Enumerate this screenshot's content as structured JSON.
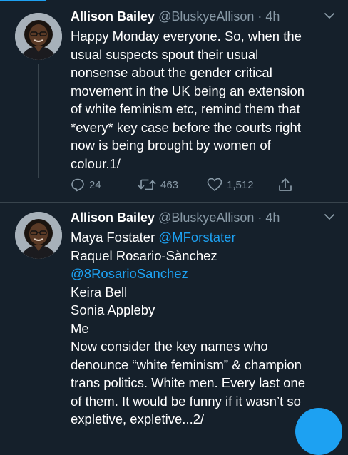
{
  "tweets": [
    {
      "author_name": "Allison Bailey",
      "handle": "@BluskyeAllison",
      "separator": "·",
      "time": "4h",
      "lines": [
        "Happy Monday everyone. So, when the",
        "usual suspects spout their usual",
        "nonsense about the gender critical",
        "movement in the UK being an extension",
        "of white feminism etc, remind them that",
        "*every* key case before the courts right",
        "now is being brought by women of",
        "colour.1/"
      ],
      "actions": {
        "replies": "24",
        "retweets": "463",
        "likes": "1,512"
      }
    },
    {
      "author_name": "Allison Bailey",
      "handle": "@BluskyeAllison",
      "separator": "·",
      "time": "4h",
      "line1_text": "Maya Fostater",
      "line1_mention": "@MForstater",
      "line2_text": "Raquel Rosario-Sànchez",
      "line3_mention": "@8RosarioSanchez",
      "lines_rest": [
        "Keira Bell",
        "Sonia Appleby",
        "Me",
        "Now consider the key names who",
        "denounce “white feminism” & champion",
        "trans politics. White men. Every last one",
        "of them. It would be funny if it wasn’t so",
        "expletive, expletive...2/"
      ]
    }
  ],
  "icons": {
    "reply": "reply-icon",
    "retweet": "retweet-icon",
    "like": "heart-icon",
    "share": "share-icon",
    "more": "chevron-down-icon",
    "compose": "compose-fab"
  },
  "colors": {
    "background": "#15202b",
    "text": "#ffffff",
    "secondary": "#8899a6",
    "accent": "#1da1f2",
    "divider": "#38444d"
  }
}
